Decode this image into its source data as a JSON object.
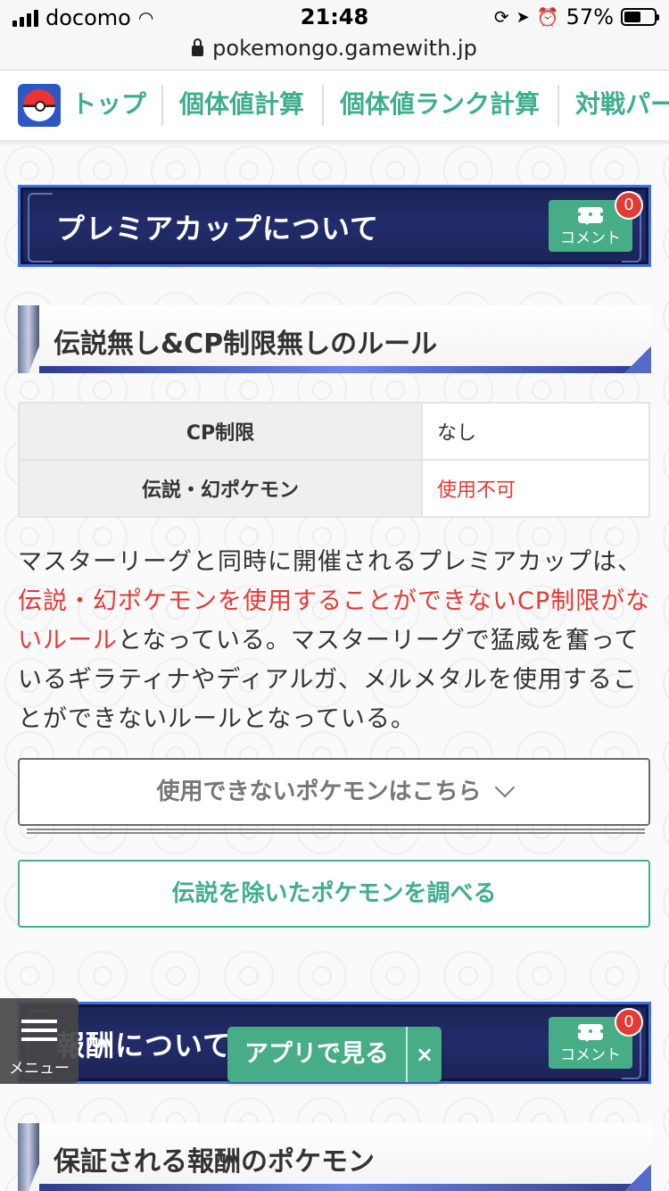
{
  "status_bar": {
    "carrier": "docomo",
    "time": "21:48",
    "battery": "57%",
    "battery_level": 0.57
  },
  "browser": {
    "url": "pokemongo.gamewith.jp"
  },
  "nav": {
    "items": [
      "トップ",
      "個体値計算",
      "個体値ランク計算",
      "対戦パー"
    ]
  },
  "section1": {
    "title": "プレミアカップについて",
    "comment_label": "コメント",
    "comment_count": "0"
  },
  "subsection1": {
    "title": "伝説無し&CP制限無しのルール"
  },
  "rules_table": {
    "rows": [
      {
        "label": "CP制限",
        "value": "なし"
      },
      {
        "label": "伝説・幻ポケモン",
        "value": "使用不可"
      }
    ]
  },
  "paragraph": {
    "part1": "マスターリーグと同時に開催されるプレミアカップは、",
    "highlight": "伝説・幻ポケモンを使用することができないCP制限がないルール",
    "part2": "となっている。マスターリーグで猛威を奮っているギラティナやディアルガ、メルメタルを使用することができないルールとなっている。"
  },
  "toggle_button": {
    "label": "使用できないポケモンはこちら"
  },
  "search_button": {
    "label": "伝説を除いたポケモンを調べる"
  },
  "section2": {
    "title": "報酬について",
    "comment_label": "コメント",
    "comment_count": "0"
  },
  "subsection2": {
    "title": "保証される報酬のポケモン"
  },
  "menu": {
    "label": "メニュー"
  },
  "app_banner": {
    "label": "アプリで見る",
    "close": "×"
  },
  "colors": {
    "accent": "#3fae8d",
    "red": "#e53935",
    "banner_bg": "#222c6b",
    "banner_border": "#3d6fe6"
  }
}
